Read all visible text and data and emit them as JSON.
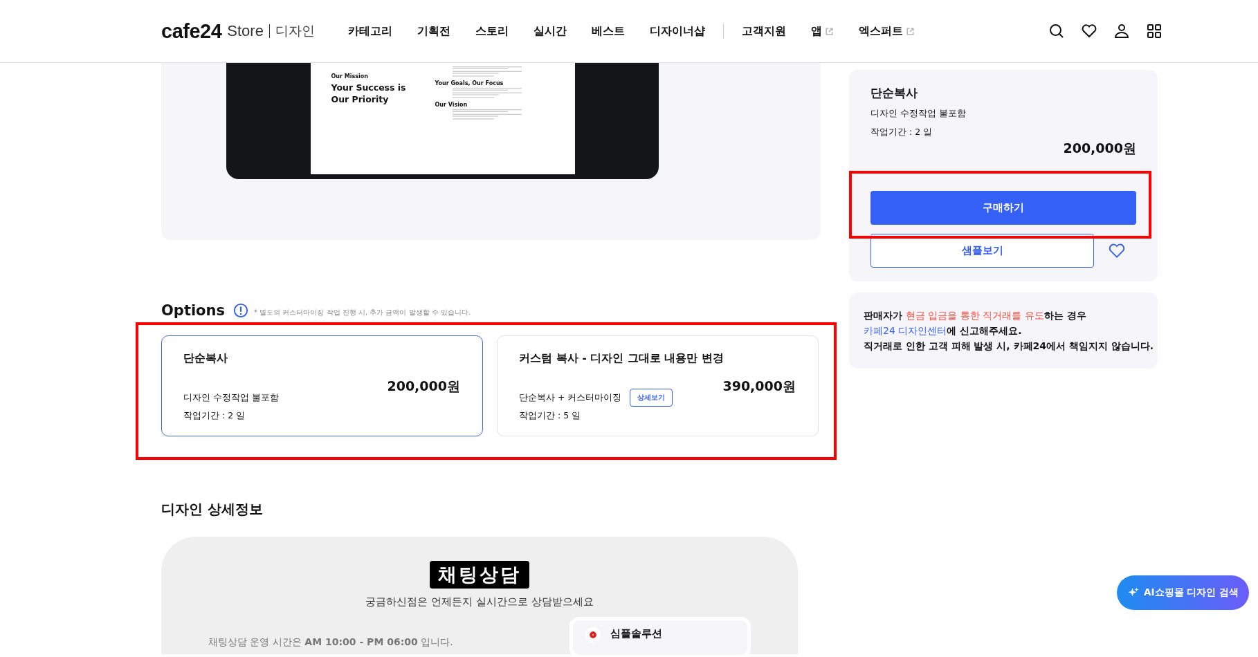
{
  "header": {
    "logo": {
      "brand": "cafe24",
      "store": "Store",
      "section": "디자인"
    },
    "nav_main": [
      {
        "label": "카테고리",
        "external": false
      },
      {
        "label": "기획전",
        "external": false
      },
      {
        "label": "스토리",
        "external": false
      },
      {
        "label": "실시간",
        "external": false
      },
      {
        "label": "베스트",
        "external": false
      },
      {
        "label": "디자이너샵",
        "external": false
      }
    ],
    "nav_support": [
      {
        "label": "고객지원",
        "external": false
      },
      {
        "label": "앱",
        "external": true
      },
      {
        "label": "엑스퍼트",
        "external": true
      }
    ]
  },
  "preview": {
    "kicker": "Our Mission",
    "headline": "Your Success is Our Priority",
    "sections": [
      "Your Goals, Our Focus",
      "Our Vision"
    ]
  },
  "options": {
    "title": "Options",
    "note": "* 별도의 커스터마이징 작업 진행 시, 추가 금액이 발생할 수 있습니다.",
    "items": [
      {
        "name": "단순복사",
        "price": "200,000원",
        "description": "디자인 수정작업 불포함",
        "period": "작업기간 : 2 일",
        "selected": true
      },
      {
        "name": "커스텀 복사 - 디자인 그대로 내용만 변경",
        "price": "390,000원",
        "description": "단순복사 + 커스터마이징",
        "detail_button": "상세보기",
        "period": "작업기간 : 5 일",
        "selected": false
      }
    ]
  },
  "detail": {
    "title": "디자인 상세정보",
    "chat": {
      "badge": "채팅상담",
      "subtitle": "궁금하신점은 언제든지 실시간으로 상담받으세요",
      "hours": "채팅상담 운영 시간은 **AM 10:00 - PM 06:00** 입니다.",
      "partner": "심플솔루션"
    }
  },
  "summary": {
    "name": "단순복사",
    "description": "디자인 수정작업 불포함",
    "period": "작업기간 : 2 일",
    "price": "200,000원",
    "buy_button": "구매하기",
    "sample_button": "샘플보기"
  },
  "notice": {
    "lines": [
      [
        {
          "kind": "plain",
          "text": "판매자가 "
        },
        {
          "kind": "warning",
          "text": "현금 입금을 통한 직거래를 유도"
        },
        {
          "kind": "plain",
          "text": "하는 경우"
        }
      ],
      [
        {
          "kind": "link",
          "text": "카페24 디자인센터"
        },
        {
          "kind": "plain",
          "text": "에 신고해주세요."
        }
      ],
      [
        {
          "kind": "plain",
          "text": "직거래로 인한 고객 피해 발생 시, 카페24에서 책임지지 않습니다."
        }
      ]
    ]
  },
  "ai_button": "AI쇼핑몰 디자인 검색"
}
